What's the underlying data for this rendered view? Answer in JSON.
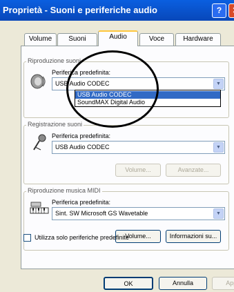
{
  "window": {
    "title": "Proprietà - Suoni e periferiche audio",
    "help_glyph": "?",
    "close_glyph": "✕"
  },
  "tabs": [
    {
      "label": "Volume"
    },
    {
      "label": "Suoni"
    },
    {
      "label": "Audio",
      "active": true
    },
    {
      "label": "Voce"
    },
    {
      "label": "Hardware"
    }
  ],
  "playback": {
    "legend": "Riproduzione suoni",
    "default_label": "Periferica predefinita:",
    "selected": "USB Audio CODEC",
    "options": [
      "USB Audio CODEC",
      "SoundMAX Digital Audio"
    ],
    "icon": "speaker-icon"
  },
  "recording": {
    "legend": "Registrazione suoni",
    "default_label": "Periferica predefinita:",
    "selected": "USB Audio CODEC",
    "volume_label": "Volume...",
    "advanced_label": "Avanzate...",
    "icon": "microphone-icon"
  },
  "midi": {
    "legend": "Riproduzione musica MIDI",
    "default_label": "Periferica predefinita:",
    "selected": "Sint. SW Microsoft GS Wavetable",
    "volume_label": "Volume...",
    "info_label": "Informazioni su...",
    "icon": "midi-keyboard-icon"
  },
  "only_default": {
    "label": "Utilizza solo periferiche predefinite",
    "checked": false
  },
  "footer": {
    "ok_label": "OK",
    "cancel_label": "Annulla",
    "apply_label": "Applica"
  },
  "colors": {
    "titlebar": "#0a5fe0",
    "selection": "#316ac5",
    "tab_highlight": "#ffc73c"
  }
}
